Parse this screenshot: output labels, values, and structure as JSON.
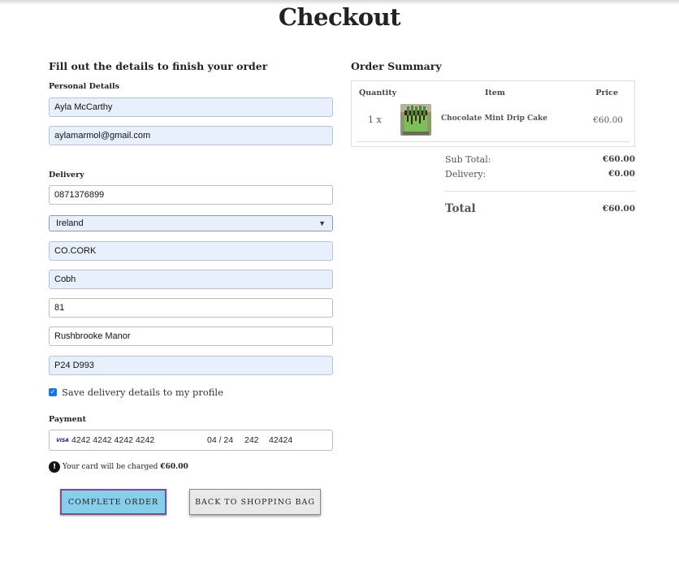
{
  "page": {
    "title": "Checkout"
  },
  "form": {
    "heading": "Fill out the details to finish your order",
    "personal_label": "Personal Details",
    "full_name": "Ayla McCarthy",
    "email": "aylamarmol@gmail.com",
    "delivery_label": "Delivery",
    "phone": "0871376899",
    "country": "Ireland",
    "county": "CO.CORK",
    "town": "Cobh",
    "street1": "81",
    "street2": "Rushbrooke Manor",
    "postcode": "P24 D993",
    "save_label": "Save delivery details to my profile",
    "save_checked": true,
    "payment_label": "Payment",
    "card": {
      "brand": "VISA",
      "number": "4242 4242 4242 4242",
      "expiry": "04 / 24",
      "cvc": "242",
      "zip": "42424"
    },
    "charge_note": "Your card will be charged",
    "charge_amount": "€60.00",
    "complete_button": "COMPLETE ORDER",
    "back_button": "BACK TO SHOPPING BAG"
  },
  "summary": {
    "heading": "Order Summary",
    "columns": {
      "quantity": "Quantity",
      "item": "Item",
      "price": "Price"
    },
    "items": [
      {
        "qty": "1 x",
        "name": "Chocolate Mint Drip Cake",
        "price": "€60.00"
      }
    ],
    "subtotal_label": "Sub Total:",
    "subtotal": "€60.00",
    "delivery_label": "Delivery:",
    "delivery": "€0.00",
    "total_label": "Total",
    "total": "€60.00"
  },
  "colors": {
    "autofill": "#e8f0fe",
    "complete_button": "#87ceeb",
    "complete_border": "#7d4f8f"
  }
}
